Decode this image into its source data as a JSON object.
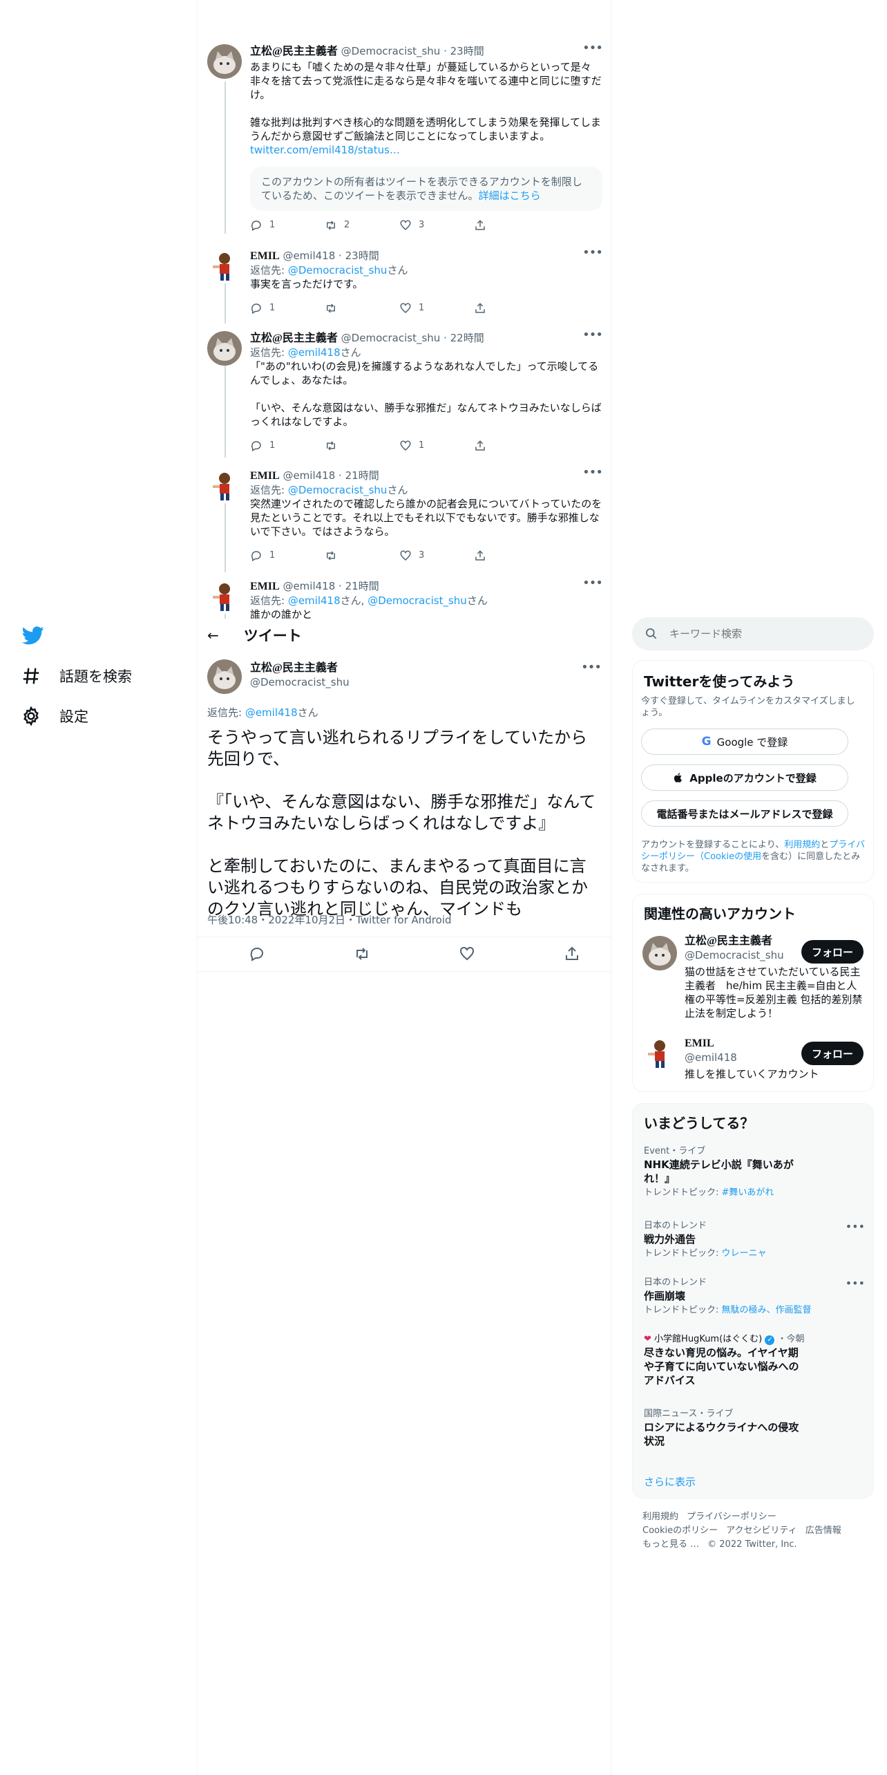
{
  "nav": {
    "explore_label": "話題を検索",
    "settings_label": "設定"
  },
  "thread": [
    {
      "name": "立松@民主主義者",
      "handle": "@Democracist_shu",
      "time": "23時間",
      "text": "あまりにも「嘘くための是々非々仕草」が蔓延しているからといって是々非々を捨て去って党派性に走るなら是々非々を嗤いてる連中と同じに堕すだけ。\n\n雑な批判は批判すべき核心的な問題を透明化してしまう効果を発揮してしまうんだから意図せずご飯論法と同じことになってしまいますよ。",
      "link": "twitter.com/emil418/status…",
      "quote_text": "このアカウントの所有者はツイートを表示できるアカウントを制限しているため、このツイートを表示できません。",
      "quote_link": "詳細はこちら",
      "reply_count": "1",
      "retweet_count": "2",
      "like_count": "3"
    },
    {
      "name": "EMIL",
      "handle": "@emil418",
      "time": "23時間",
      "reply_to_prefix": "返信先: ",
      "reply_to": "@Democracist_shu",
      "reply_to_suffix": "さん",
      "text": "事実を言っただけです。",
      "reply_count": "1",
      "retweet_count": "",
      "like_count": "1"
    },
    {
      "name": "立松@民主主義者",
      "handle": "@Democracist_shu",
      "time": "22時間",
      "reply_to_prefix": "返信先: ",
      "reply_to": "@emil418",
      "reply_to_suffix": "さん",
      "text": "「\"あの\"れいわ(の会見)を擁護するようなあれな人でした」って示唆してるんでしょ、あなたは。\n\n「いや、そんな意図はない、勝手な邪推だ」なんてネトウヨみたいなしらばっくれはなしですよ。",
      "reply_count": "1",
      "retweet_count": "",
      "like_count": "1"
    },
    {
      "name": "EMIL",
      "handle": "@emil418",
      "time": "21時間",
      "reply_to_prefix": "返信先: ",
      "reply_to": "@Democracist_shu",
      "reply_to_suffix": "さん",
      "text": "突然連ツイされたので確認したら誰かの記者会見についてバトっていたのを見たということです。それ以上でもそれ以下でもないです。勝手な邪推しないで下さい。ではさようなら。",
      "reply_count": "1",
      "retweet_count": "",
      "like_count": "3"
    },
    {
      "name": "EMIL",
      "handle": "@emil418",
      "time": "21時間",
      "reply_to_prefix": "返信先: ",
      "reply_to": "@emil418",
      "reply_to_sep": "さん, ",
      "reply_to_2": "@Democracist_shu",
      "reply_to_suffix": "さん",
      "text": "誰かの誰かと"
    }
  ],
  "header": {
    "title": "ツイート"
  },
  "main_tweet": {
    "name": "立松@民主主義者",
    "handle": "@Democracist_shu",
    "reply_to_prefix": "返信先: ",
    "reply_to": "@emil418",
    "reply_to_suffix": "さん",
    "text": "そうやって言い逃れられるリプライをしていたから先回りで、\n\n『「いや、そんな意図はない、勝手な邪推だ」なんてネトウヨみたいなしらばっくれはなしですよ』\n\nと牽制しておいたのに、まんまやるって真面目に言い逃れるつもりすらないのね、自民党の政治家とかのクソ言い逃れと同じじゃん、マインドも",
    "time": "午後10:48",
    "date": "2022年10月2日",
    "source": "Twitter for Android"
  },
  "search": {
    "placeholder": "キーワード検索"
  },
  "signup": {
    "title": "Twitterを使ってみよう",
    "subtitle": "今すぐ登録して、タイムラインをカスタマイズしましょう。",
    "google_label": "Google で登録",
    "apple_label": "Appleのアカウントで登録",
    "phone_label": "電話番号またはメールアドレスで登録",
    "terms_prefix": "アカウントを登録することにより、",
    "terms_link": "利用規約",
    "terms_and": "と",
    "privacy_link": "プライバシーポリシー",
    "cookie_link": "（Cookieの使用",
    "terms_suffix": "を含む）に同意したとみなされます。"
  },
  "related": {
    "title": "関連性の高いアカウント",
    "follow_label": "フォロー",
    "accounts": [
      {
        "name": "立松@民主主義者",
        "handle": "@Democracist_shu",
        "bio": "猫の世話をさせていただいている民主主義者　he/him 民主主義=自由と人権の平等性=反差別主義 包括的差別禁止法を制定しよう！"
      },
      {
        "name": "EMIL",
        "handle": "@emil418",
        "bio": "推しを推していくアカウント"
      }
    ]
  },
  "trends": {
    "title": "いまどうしてる？",
    "items": [
      {
        "meta": "Event・ライブ",
        "title": "NHK連続テレビ小説『舞いあがれ！』",
        "topic_prefix": "トレンドトピック: ",
        "topic": "#舞いあがれ"
      },
      {
        "meta": "日本のトレンド",
        "title": "戦力外通告",
        "topic_prefix": "トレンドトピック: ",
        "topic": "ウレーニャ"
      },
      {
        "meta": "日本のトレンド",
        "title": "作画崩壊",
        "topic_prefix": "トレンドトピック: ",
        "topic": "無駄の極み、作画監督"
      },
      {
        "meta": "小学館HugKum(はぐくむ)",
        "meta_suffix": "・今朝",
        "title": "尽きない育児の悩み。イヤイヤ期や子育てに向いていない悩みへのアドバイス"
      },
      {
        "meta": "国際ニュース・ライブ",
        "title": "ロシアによるウクライナへの侵攻状況"
      }
    ],
    "show_more": "さらに表示"
  },
  "footer": {
    "terms": "利用規約",
    "privacy": "プライバシーポリシー",
    "cookie": "Cookieのポリシー",
    "accessibility": "アクセシビリティ",
    "ads": "広告情報",
    "more": "もっと見る …",
    "copyright": "© 2022 Twitter, Inc."
  },
  "colors": {
    "accent": "#1d9bf0",
    "text": "#0f1419",
    "muted": "#536471",
    "border": "#eff3f4",
    "panel": "#f7f9f9"
  }
}
